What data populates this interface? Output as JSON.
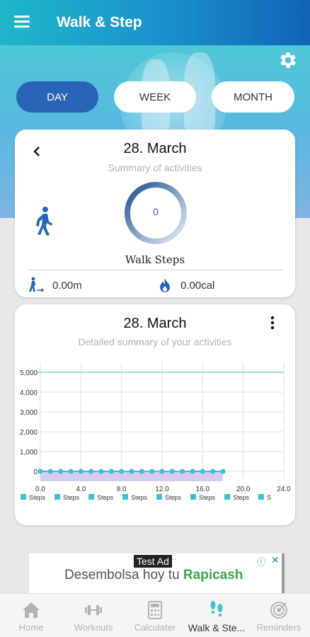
{
  "app": {
    "title": "Walk & Step"
  },
  "icons": {
    "menu": "menu-icon",
    "settings": "gear-icon",
    "back": "chevron-left-icon",
    "walker": "walking-person-icon",
    "distance": "walking-distance-icon",
    "calories": "flame-icon",
    "more": "more-vertical-icon"
  },
  "colors": {
    "accent": "#2a64b6",
    "chart_line": "#3ec1d3",
    "goal_line": "#7fd6d9",
    "area": "#d6ccef"
  },
  "tabs": [
    {
      "label": "DAY",
      "active": true
    },
    {
      "label": "WEEK",
      "active": false
    },
    {
      "label": "MONTH",
      "active": false
    }
  ],
  "summary_card": {
    "date": "28. March",
    "subtitle": "Summary of activities",
    "steps_value": "0",
    "steps_label": "Walk Steps",
    "distance": "0.00m",
    "calories": "0.00cal"
  },
  "detail_card": {
    "date": "28. March",
    "subtitle": "Detailed summary of your activities"
  },
  "chart_data": {
    "type": "line",
    "title": "",
    "xlabel": "",
    "ylabel": "",
    "x_ticks": [
      "0.0",
      "4.0",
      "8.0",
      "12.0",
      "16.0",
      "20.0",
      "24.0"
    ],
    "y_ticks": [
      "0",
      "1,000",
      "2,000",
      "3,000",
      "4,000",
      "5,000"
    ],
    "xlim": [
      0,
      24
    ],
    "ylim": [
      0,
      5000
    ],
    "goal_line": 5000,
    "series": [
      {
        "name": "Steps",
        "x": [
          0,
          1,
          2,
          3,
          4,
          5,
          6,
          7,
          8,
          9,
          10,
          11,
          12,
          13,
          14,
          15,
          16,
          17,
          18
        ],
        "values": [
          0,
          0,
          0,
          0,
          0,
          0,
          0,
          0,
          0,
          0,
          0,
          0,
          0,
          0,
          0,
          0,
          0,
          0,
          0
        ]
      }
    ],
    "legend_entries": [
      "Steps",
      "Steps",
      "Steps",
      "Steps",
      "Steps",
      "Steps",
      "Steps",
      "S"
    ],
    "legend_position": "bottom",
    "grid": true
  },
  "ad": {
    "tag": "Test Ad",
    "text": "Desembolsa hoy tu ",
    "brand": "Rapicash",
    "info": "ⓘ",
    "close": "✕"
  },
  "bottom_nav": [
    {
      "label": "Home",
      "icon": "home-icon",
      "active": false
    },
    {
      "label": "Workouts",
      "icon": "dumbbell-icon",
      "active": false
    },
    {
      "label": "Calculater",
      "icon": "calculator-icon",
      "active": false
    },
    {
      "label": "Walk & Ste...",
      "icon": "footsteps-icon",
      "active": true
    },
    {
      "label": "Reminders",
      "icon": "target-icon",
      "active": false
    }
  ]
}
